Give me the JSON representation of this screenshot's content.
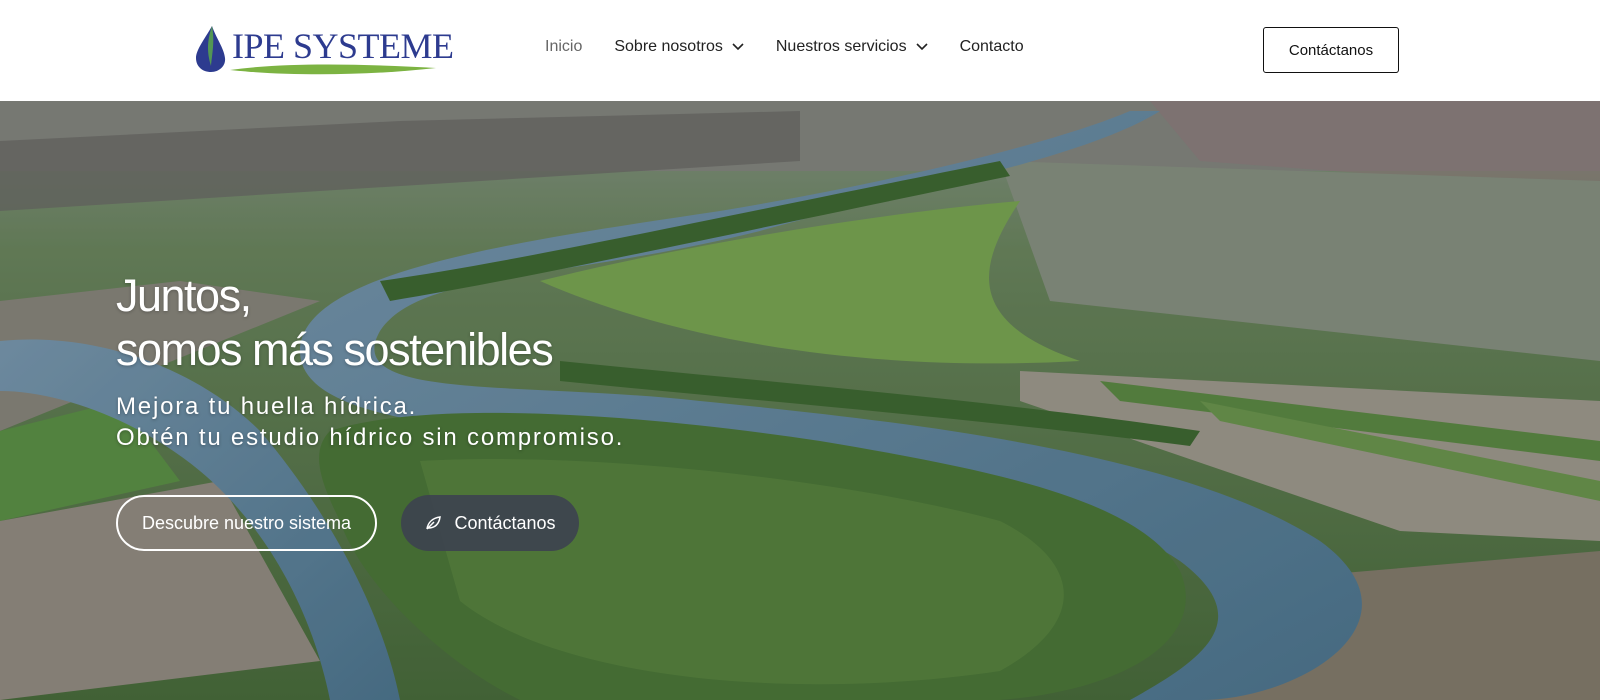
{
  "brand": {
    "name": "IPE SYSTEME",
    "colors": {
      "primary": "#2d3b8f",
      "accent_green": "#7cb342"
    }
  },
  "nav": {
    "items": [
      {
        "label": "Inicio",
        "active": true,
        "has_dropdown": false
      },
      {
        "label": "Sobre nosotros",
        "active": false,
        "has_dropdown": true
      },
      {
        "label": "Nuestros servicios",
        "active": false,
        "has_dropdown": true
      },
      {
        "label": "Contacto",
        "active": false,
        "has_dropdown": false
      }
    ],
    "cta_label": "Contáctanos"
  },
  "hero": {
    "title_line1": "Juntos,",
    "title_line2": "somos más sostenibles",
    "subtitle_line1": "Mejora tu huella hídrica.",
    "subtitle_line2": "Obtén tu estudio hídrico sin compromiso.",
    "primary_button": "Descubre nuestro sistema",
    "secondary_button": "Contáctanos",
    "secondary_button_icon": "leaf-icon"
  }
}
